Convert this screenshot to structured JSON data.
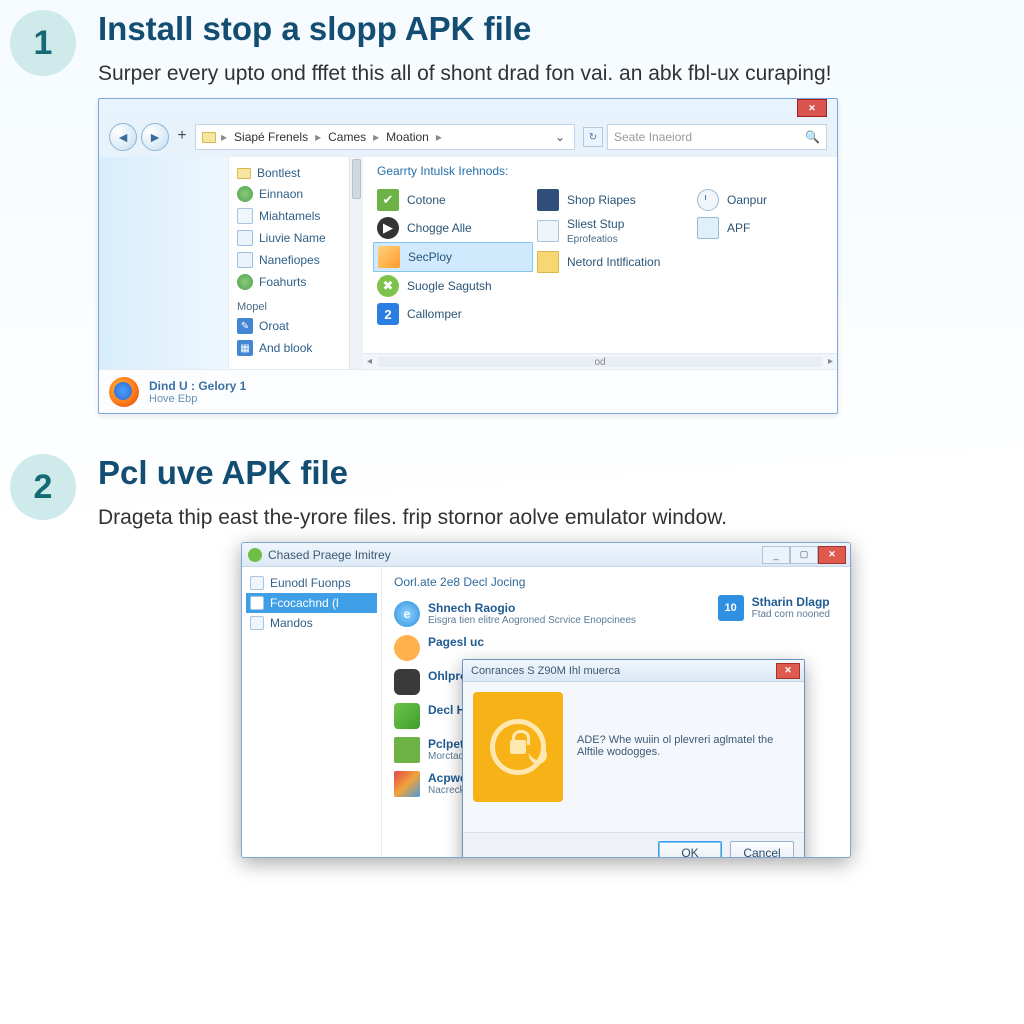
{
  "steps": [
    {
      "number": "1",
      "title": "Install stop a slopp APK file",
      "desc": "Surper every upto ond fffet this all of shont drad fon vai. an abk fbl-ux curaping!"
    },
    {
      "number": "2",
      "title": "Pcl uve APK file",
      "desc": "Drageta thip east the-yrore files. frip stornor aolve emulator window."
    }
  ],
  "explorer": {
    "breadcrumbs": [
      "Siapé Frenels",
      "Cames",
      "Moation"
    ],
    "dropdown_glyph": "⌄",
    "search_placeholder": "Seate Inaeiord",
    "sidebar_upper": [
      {
        "icon": "folder",
        "label": "Bontlest"
      },
      {
        "icon": "globe",
        "label": "Einnaon"
      },
      {
        "icon": "doc",
        "label": "Miahtamels"
      },
      {
        "icon": "blue",
        "label": "Liuvie Name"
      },
      {
        "icon": "blue",
        "label": "Nanefiopes"
      },
      {
        "icon": "globe",
        "label": "Foahurts"
      }
    ],
    "sidebar_group": "Mopel",
    "sidebar_lower": [
      {
        "icon": "bsq",
        "label": "Oroat"
      },
      {
        "icon": "bsq",
        "label": "And blook"
      }
    ],
    "section_label": "Gearrty Intulsk Irehnods:",
    "col1": [
      {
        "icon": "green",
        "label": "Cotone"
      },
      {
        "icon": "dark",
        "label": "Chogge Alle"
      },
      {
        "icon": "orange",
        "label": "SecPloy",
        "selected": true
      },
      {
        "icon": "wrench",
        "label": "Suogle Sagutsh"
      },
      {
        "icon": "two",
        "label": "Callomper"
      }
    ],
    "col2": [
      {
        "icon": "tv",
        "label": "Shop Riapes"
      },
      {
        "icon": "doc",
        "label": "Sliest Stup",
        "sub": "Eprofeatios"
      },
      {
        "icon": "yfld",
        "label": "Netord Intlfication"
      }
    ],
    "col3": [
      {
        "icon": "clock",
        "label": "Oanpur"
      },
      {
        "icon": "pic",
        "label": "APF"
      }
    ],
    "hscroll_center": "od",
    "status": {
      "l1": "Dind U : Gelory 1",
      "l2": "Hove Ebp"
    }
  },
  "panel": {
    "window_title": "Chased Praege Imitrey",
    "sidebar": [
      {
        "label": "Eunodl Fuonps",
        "sel": false
      },
      {
        "label": "Fcocachnd  (l",
        "sel": true
      },
      {
        "label": "Mandos",
        "sel": false
      }
    ],
    "section_label": "Oorl.ate 2e8 Decl Jocing",
    "rows": [
      {
        "icon": "e",
        "l1": "Shnech Raogio",
        "l2": "Eisgra tien elitre Aogroned Scrvice Enopcinees"
      },
      {
        "icon": "gear",
        "l1": "Pagesl uc",
        "l2": ""
      },
      {
        "icon": "dark2",
        "l1": "Ohlproke",
        "l2": ""
      },
      {
        "icon": "cube",
        "l1": "Decl Hagr",
        "l2": ""
      },
      {
        "icon": "green",
        "l1": "Pclpet Eitgi",
        "l2": "Morctacedd"
      },
      {
        "icon": "mix",
        "l1": "Acpwelf",
        "l2": "Nacreckegod Pannitnd"
      }
    ],
    "right_item": {
      "num": "10",
      "l1": "Stharin Dlagp",
      "l2": "Ftad corn nooned"
    },
    "dialog": {
      "title": "Conrances S Z90M Ihl muerca",
      "body": "ADE?  Whe wuiin ol plevreri aglmatel the Alftile wodogges.",
      "ok": "OK",
      "cancel": "Cancel"
    }
  }
}
